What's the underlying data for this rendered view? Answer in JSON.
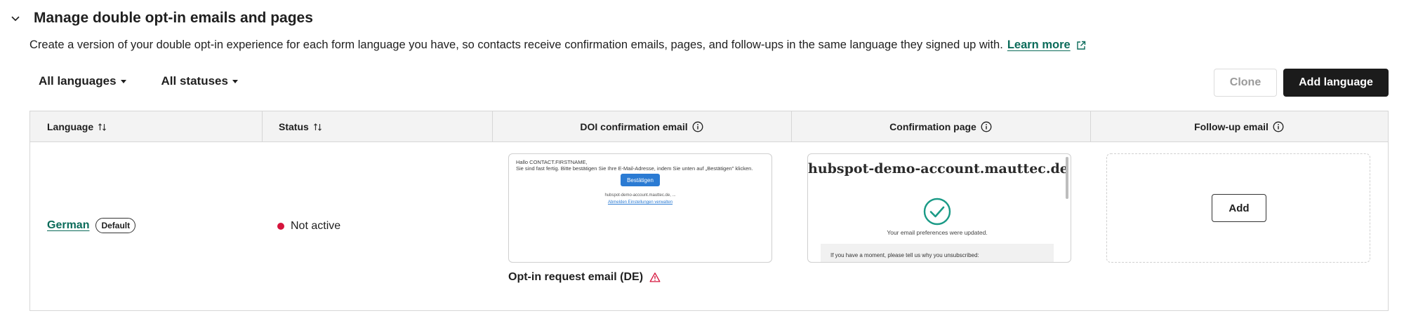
{
  "section": {
    "title": "Manage double opt-in emails and pages",
    "description": "Create a version of your double opt-in experience for each form language you have, so contacts receive confirmation emails, pages, and follow-ups in the same language they signed up with.",
    "learn_more": "Learn more"
  },
  "filters": {
    "languages": "All languages",
    "statuses": "All statuses"
  },
  "actions": {
    "clone": "Clone",
    "add_language": "Add language"
  },
  "table": {
    "headers": {
      "language": "Language",
      "status": "Status",
      "doi_email": "DOI confirmation email",
      "confirmation_page": "Confirmation page",
      "followup_email": "Follow-up email"
    },
    "rows": [
      {
        "language": "German",
        "badge": "Default",
        "status": "Not active",
        "status_color": "#d5143c",
        "email_preview": {
          "greeting": "Hallo CONTACT.FIRSTNAME,",
          "body": "Sie sind fast fertig. Bitte bestätigen Sie Ihre E-Mail-Adresse, indem Sie unten auf „Bestätigen\" klicken.",
          "button": "Bestätigen",
          "footer": "hubspot-demo-account.mauttec.de, ...",
          "footer_link": "Abmelden Einstellungen verwalten"
        },
        "email_name": "Opt-in request email (DE)",
        "page_preview": {
          "title": "hubspot-demo-account.mauttec.de",
          "message": "Your email preferences were updated.",
          "prompt": "If you have a moment, please tell us why you unsubscribed:"
        },
        "followup_action": "Add"
      }
    ]
  },
  "colors": {
    "link": "#0b6b5a",
    "primary_button": "#1b1b1b",
    "warning": "#d5143c",
    "check": "#1a9a86"
  }
}
